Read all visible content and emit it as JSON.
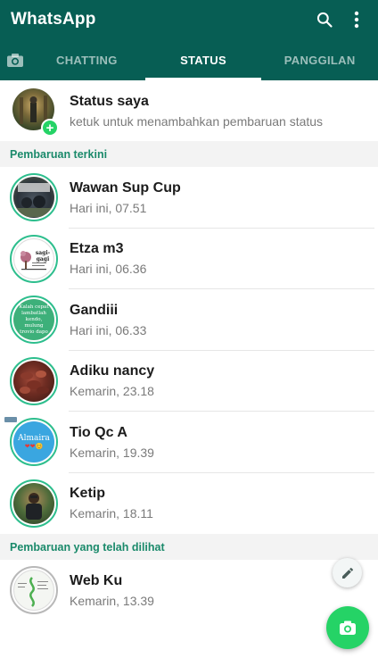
{
  "app": {
    "title": "WhatsApp"
  },
  "icons": {
    "search": "search-icon",
    "more": "more-vert-icon",
    "camera_tab": "camera-icon",
    "pencil": "pencil-icon",
    "camera_fab": "camera-icon",
    "add": "add-icon"
  },
  "tabs": [
    {
      "label": "CHATTING",
      "active": false
    },
    {
      "label": "STATUS",
      "active": true
    },
    {
      "label": "PANGGILAN",
      "active": false
    }
  ],
  "my_status": {
    "title": "Status saya",
    "subtitle": "ketuk untuk menambahkan pembaruan status"
  },
  "sections": {
    "recent": "Pembaruan terkini",
    "viewed": "Pembaruan yang telah dilihat"
  },
  "recent_updates": [
    {
      "name": "Wawan Sup Cup",
      "time": "Hari ini, 07.51"
    },
    {
      "name": "Etza m3",
      "time": "Hari ini, 06.36"
    },
    {
      "name": "Gandiii",
      "time": "Hari ini, 06.33"
    },
    {
      "name": "Adiku nancy",
      "time": "Kemarin, 23.18"
    },
    {
      "name": "Tio Qc A",
      "time": "Kemarin, 19.39"
    },
    {
      "name": "Ketip",
      "time": "Kemarin, 18.11"
    }
  ],
  "viewed_updates": [
    {
      "name": "Web Ku",
      "time": "Kemarin, 13.39"
    }
  ],
  "thumb_text": {
    "etza_logo": "sagi-gagi",
    "gandiii_quote": "Kalah cepat lambatlah kendo, mulung trovio dapo",
    "tio_name": "Almaira",
    "tio_emoji": "❤❤😊"
  },
  "colors": {
    "appbar": "#075e54",
    "accent": "#25d366",
    "ring_unseen": "#2dbe8d",
    "ring_seen": "#b8b8b8",
    "section_text": "#1b8a6b"
  }
}
